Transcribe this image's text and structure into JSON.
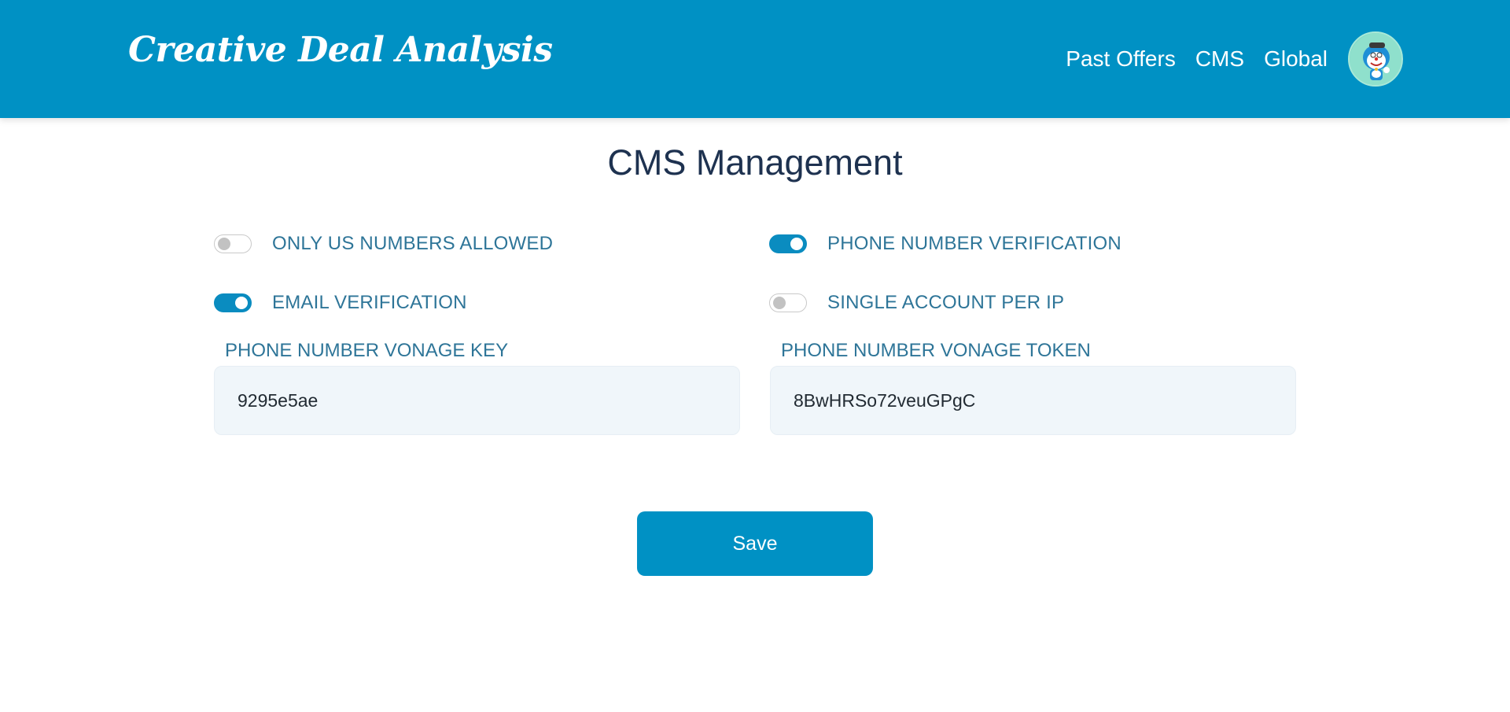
{
  "header": {
    "brand": "Creative Deal Analysis",
    "nav": [
      {
        "label": "Past Offers"
      },
      {
        "label": "CMS"
      },
      {
        "label": "Global"
      }
    ],
    "avatar_icon": "cartoon-avatar"
  },
  "page": {
    "title": "CMS Management"
  },
  "toggles": [
    {
      "label": "ONLY US NUMBERS ALLOWED",
      "state": "off"
    },
    {
      "label": "PHONE NUMBER VERIFICATION",
      "state": "on"
    },
    {
      "label": "EMAIL VERIFICATION",
      "state": "on"
    },
    {
      "label": "SINGLE ACCOUNT PER IP",
      "state": "off"
    }
  ],
  "fields": {
    "vonage_key": {
      "label": "PHONE NUMBER VONAGE KEY",
      "value": "9295e5ae"
    },
    "vonage_token": {
      "label": "PHONE NUMBER VONAGE TOKEN",
      "value": "8BwHRSo72veuGPgC"
    }
  },
  "actions": {
    "save_label": "Save"
  },
  "colors": {
    "header_bg": "#0091c4",
    "accent": "#0a8cc0",
    "label_text": "#2e7598",
    "title_text": "#1e3250",
    "input_bg": "#f0f6fa"
  }
}
